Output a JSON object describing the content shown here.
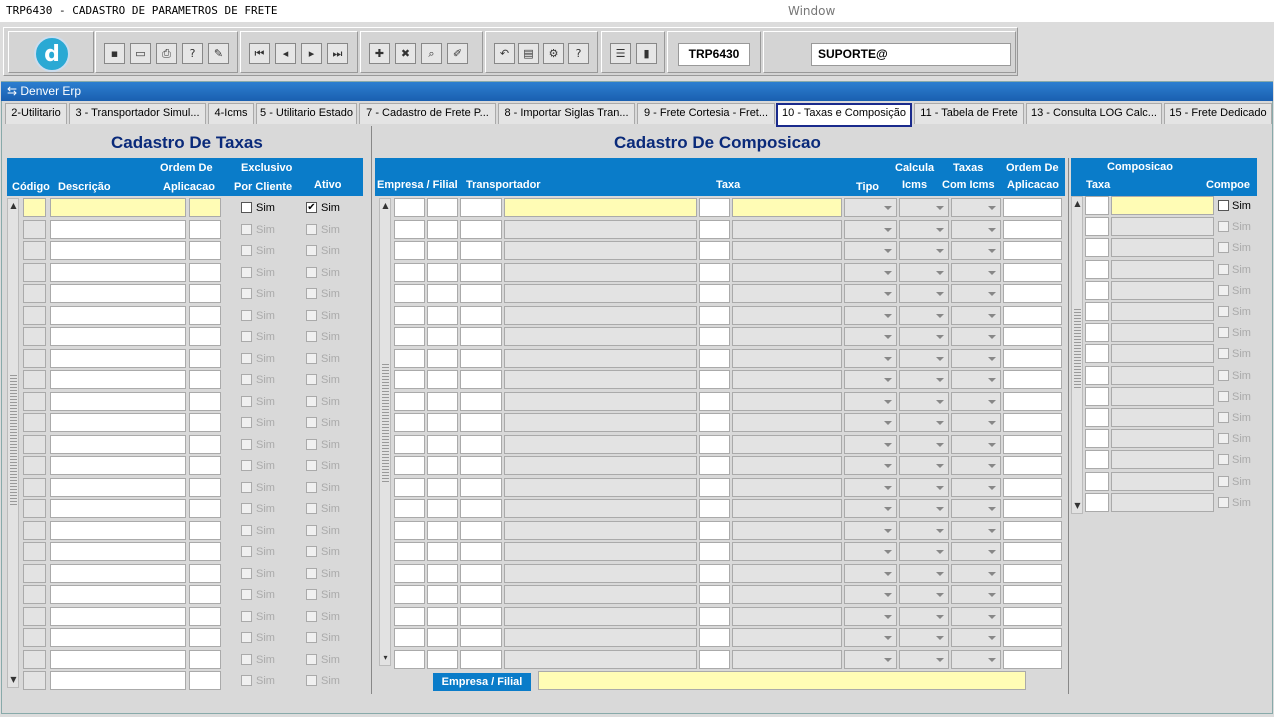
{
  "app": {
    "title": "TRP6430 - CADASTRO DE PARAMETROS DE FRETE",
    "menu_window": "Window",
    "frame_title": "Denver Erp"
  },
  "toolbar": {
    "module_code": "TRP6430",
    "user": "SUPORTE@"
  },
  "tabs": [
    {
      "label": "2-Utilitario"
    },
    {
      "label": "3 - Transportador Simul..."
    },
    {
      "label": "4-Icms"
    },
    {
      "label": "5 - Utilitario Estado"
    },
    {
      "label": "7 - Cadastro de Frete P..."
    },
    {
      "label": "8 - Importar Siglas Tran..."
    },
    {
      "label": "9 - Frete Cortesia - Fret..."
    },
    {
      "label": "10 - Taxas e Composição"
    },
    {
      "label": "11 - Tabela de Frete"
    },
    {
      "label": "13 - Consulta LOG Calc..."
    },
    {
      "label": "15 - Frete Dedicado"
    }
  ],
  "taxas": {
    "title": "Cadastro De Taxas",
    "col_codigo": "Código",
    "col_descricao": "Descrição",
    "col_ordem_1": "Ordem De",
    "col_ordem_2": "Aplicacao",
    "col_exclusivo_1": "Exclusivo",
    "col_exclusivo_2": "Por Cliente",
    "col_ativo": "Ativo",
    "checkbox_label": "Sim",
    "first_row": {
      "exclusivo_checked": false,
      "ativo_checked": true
    }
  },
  "composicao": {
    "title": "Cadastro De Composicao",
    "col_empresa": "Empresa / Filial",
    "col_transportador": "Transportador",
    "col_taxa": "Taxa",
    "col_tipo": "Tipo",
    "col_calcula_1": "Calcula",
    "col_calcula_2": "Icms",
    "col_taxas_icms_1": "Taxas",
    "col_taxas_icms_2": "Com Icms",
    "col_ordem_1": "Ordem De",
    "col_ordem_2": "Aplicacao",
    "bottom_label": "Empresa / Filial"
  },
  "composicao_side": {
    "title": "Composicao",
    "col_taxa": "Taxa",
    "col_compoe": "Compoe",
    "checkbox_label": "Sim"
  }
}
